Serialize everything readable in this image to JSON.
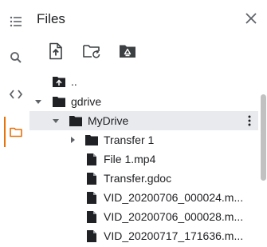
{
  "header": {
    "title": "Files"
  },
  "rail": {
    "items": [
      {
        "icon": "list-icon"
      },
      {
        "icon": "search-icon"
      },
      {
        "icon": "code-icon"
      },
      {
        "icon": "folder-icon",
        "active": true
      }
    ],
    "accent_color": "#e8710a"
  },
  "toolbar": {
    "buttons": [
      {
        "icon": "upload-file-icon"
      },
      {
        "icon": "refresh-folder-icon"
      },
      {
        "icon": "mount-drive-icon"
      }
    ]
  },
  "tree": {
    "rows": [
      {
        "label": "..",
        "type": "parent-folder"
      },
      {
        "label": "gdrive",
        "type": "folder",
        "expanded": true
      },
      {
        "label": "MyDrive",
        "type": "folder",
        "expanded": true,
        "selected": true
      },
      {
        "label": "Transfer 1",
        "type": "folder",
        "expanded": false
      },
      {
        "label": "File 1.mp4",
        "type": "file"
      },
      {
        "label": "Transfer.gdoc",
        "type": "file"
      },
      {
        "label": "VID_20200706_000024.m...",
        "type": "file"
      },
      {
        "label": "VID_20200706_000028.m...",
        "type": "file"
      },
      {
        "label": "VID_20200717_171636.m...",
        "type": "file"
      }
    ]
  },
  "colors": {
    "selected_row": "#e8eaed",
    "icon": "#5f6368",
    "folder": "#202124",
    "scroll_thumb": "#c1c1c1"
  }
}
